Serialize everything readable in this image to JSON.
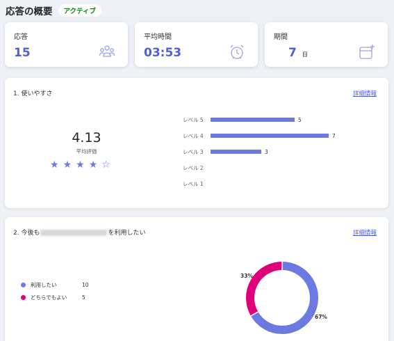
{
  "header": {
    "title": "応答の概要",
    "status": "アクティブ"
  },
  "stats": [
    {
      "label": "応答",
      "value": "15",
      "icon": "people-icon"
    },
    {
      "label": "平均時間",
      "value": "03:53",
      "icon": "alarm-clock-icon"
    },
    {
      "label": "期間",
      "value": "7",
      "unit": "日",
      "icon": "calendar-sparkle-icon"
    }
  ],
  "q1": {
    "title": "1. 使いやすさ",
    "detail_link": "詳細情報",
    "average": "4.13",
    "average_label": "平均評価",
    "rating": 4,
    "max_rating": 5,
    "rows": [
      {
        "label": "レベル 5",
        "count": 5,
        "count_text": "5"
      },
      {
        "label": "レベル 4",
        "count": 7,
        "count_text": "7"
      },
      {
        "label": "レベル 3",
        "count": 3,
        "count_text": "3"
      },
      {
        "label": "レベル 2",
        "count": 0,
        "count_text": ""
      },
      {
        "label": "レベル 1",
        "count": 0,
        "count_text": ""
      }
    ]
  },
  "q2": {
    "title_prefix": "2. 今後も",
    "title_suffix": "を利用したい",
    "detail_link": "詳細情報",
    "options": [
      {
        "label": "利用したい",
        "count": "10",
        "value": 10,
        "percent": "67%",
        "color": "#6b7ae0"
      },
      {
        "label": "どちらでもよい",
        "count": "5",
        "value": 5,
        "percent": "33%",
        "color": "#e0007a"
      }
    ]
  }
}
